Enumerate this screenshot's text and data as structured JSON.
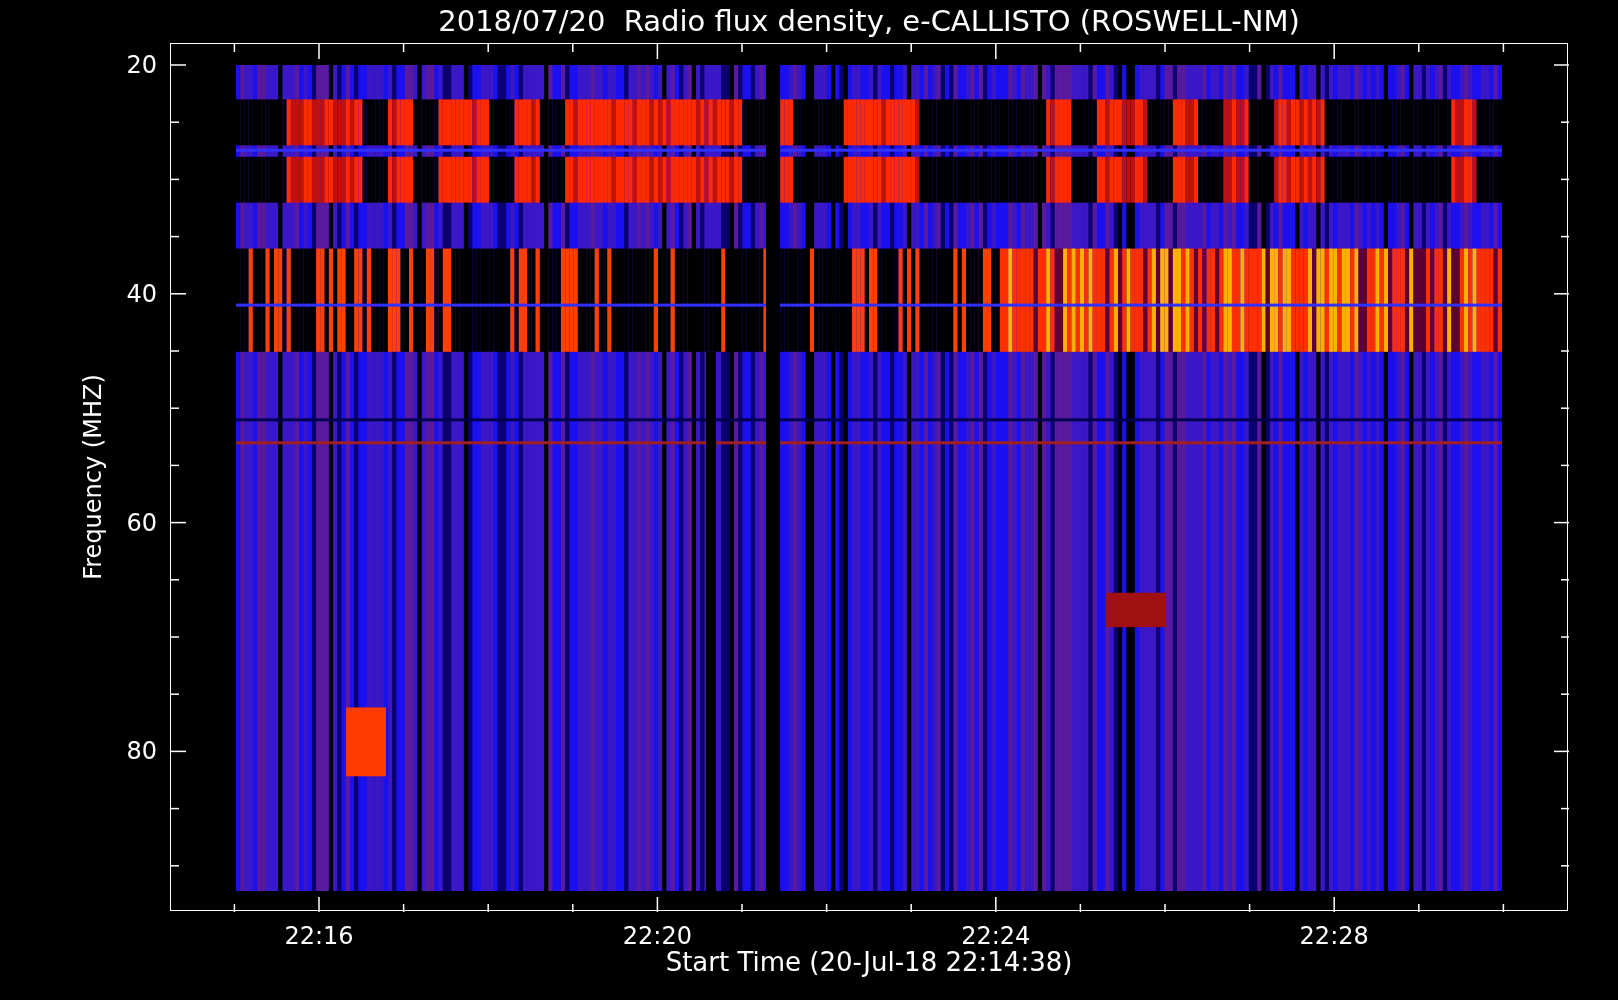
{
  "title": "2018/07/20  Radio flux density, e-CALLISTO (ROSWELL-NM)",
  "y_axis": {
    "label": "Frequency (MHZ)",
    "ticks": [
      "20",
      "40",
      "60",
      "80"
    ]
  },
  "x_axis": {
    "label": "Start Time (20-Jul-18 22:14:38)",
    "ticks": [
      "22:16",
      "22:20",
      "22:24",
      "22:28"
    ]
  }
}
